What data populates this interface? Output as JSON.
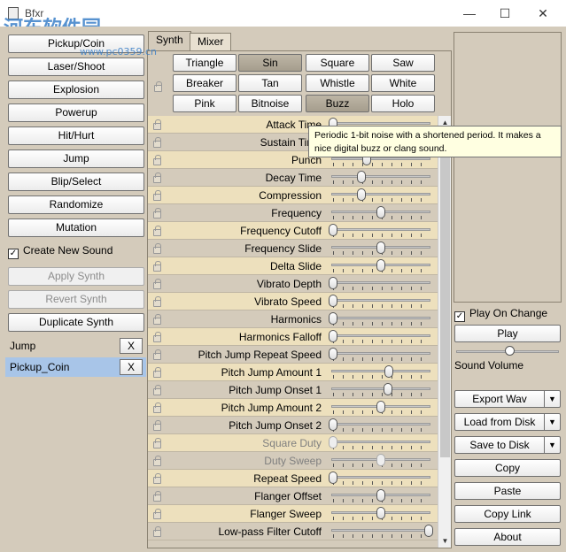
{
  "window": {
    "title": "Bfxr",
    "watermark": "河东软件园",
    "watermark_url": "www.pc0359.cn",
    "minimize": "—",
    "maximize": "☐",
    "close": "✕"
  },
  "left": {
    "buttons": [
      {
        "label": "Pickup/Coin"
      },
      {
        "label": "Laser/Shoot"
      },
      {
        "label": "Explosion"
      },
      {
        "label": "Powerup"
      },
      {
        "label": "Hit/Hurt"
      },
      {
        "label": "Jump"
      },
      {
        "label": "Blip/Select"
      },
      {
        "label": "Randomize"
      },
      {
        "label": "Mutation"
      }
    ],
    "create_new_sound": "Create New Sound",
    "create_new_sound_checked": true,
    "apply_synth": "Apply Synth",
    "revert_synth": "Revert Synth",
    "duplicate_synth": "Duplicate Synth",
    "sounds": [
      {
        "name": "Jump",
        "remove": "X"
      },
      {
        "name": "Pickup_Coin",
        "remove": "X"
      }
    ]
  },
  "tabs": [
    {
      "label": "Synth"
    },
    {
      "label": "Mixer"
    }
  ],
  "waveforms": [
    {
      "label": "Triangle"
    },
    {
      "label": "Sin"
    },
    {
      "label": "Square"
    },
    {
      "label": "Saw"
    },
    {
      "label": "Breaker"
    },
    {
      "label": "Tan"
    },
    {
      "label": "Whistle"
    },
    {
      "label": "White"
    },
    {
      "label": "Pink"
    },
    {
      "label": "Bitnoise"
    },
    {
      "label": "Buzz"
    },
    {
      "label": "Holo"
    }
  ],
  "selected_waveforms": [
    "Sin",
    "Buzz"
  ],
  "tooltip": "Periodic 1-bit noise with a shortened period. It makes a nice digital buzz or clang sound.",
  "params": [
    {
      "label": "Attack Time",
      "value": 0.0
    },
    {
      "label": "Sustain Time",
      "value": 0.3
    },
    {
      "label": "Punch",
      "value": 0.35
    },
    {
      "label": "Decay Time",
      "value": 0.3
    },
    {
      "label": "Compression",
      "value": 0.3
    },
    {
      "label": "Frequency",
      "value": 0.5
    },
    {
      "label": "Frequency Cutoff",
      "value": 0.0
    },
    {
      "label": "Frequency Slide",
      "value": 0.5
    },
    {
      "label": "Delta Slide",
      "value": 0.5
    },
    {
      "label": "Vibrato Depth",
      "value": 0.0
    },
    {
      "label": "Vibrato Speed",
      "value": 0.0
    },
    {
      "label": "Harmonics",
      "value": 0.0
    },
    {
      "label": "Harmonics Falloff",
      "value": 0.0
    },
    {
      "label": "Pitch Jump Repeat Speed",
      "value": 0.0
    },
    {
      "label": "Pitch Jump Amount 1",
      "value": 0.58
    },
    {
      "label": "Pitch Jump Onset 1",
      "value": 0.57
    },
    {
      "label": "Pitch Jump Amount 2",
      "value": 0.5
    },
    {
      "label": "Pitch Jump Onset 2",
      "value": 0.0
    },
    {
      "label": "Square Duty",
      "value": 0.0,
      "disabled": true
    },
    {
      "label": "Duty Sweep",
      "value": 0.5,
      "disabled": true
    },
    {
      "label": "Repeat Speed",
      "value": 0.0
    },
    {
      "label": "Flanger Offset",
      "value": 0.5
    },
    {
      "label": "Flanger Sweep",
      "value": 0.5
    },
    {
      "label": "Low-pass Filter Cutoff",
      "value": 1.0
    }
  ],
  "right": {
    "play_on_change": "Play On Change",
    "play_on_change_checked": true,
    "play": "Play",
    "sound_volume": "Sound Volume",
    "sound_volume_value": 0.5,
    "export_wav": "Export Wav",
    "load_from_disk": "Load from Disk",
    "save_to_disk": "Save to Disk",
    "copy": "Copy",
    "paste": "Paste",
    "copy_link": "Copy Link",
    "about": "About"
  },
  "icons": {
    "lock": "lock-icon",
    "dropdown": "▼",
    "checkmark": "✓",
    "scroll_up": "▲",
    "scroll_down": "▼"
  }
}
